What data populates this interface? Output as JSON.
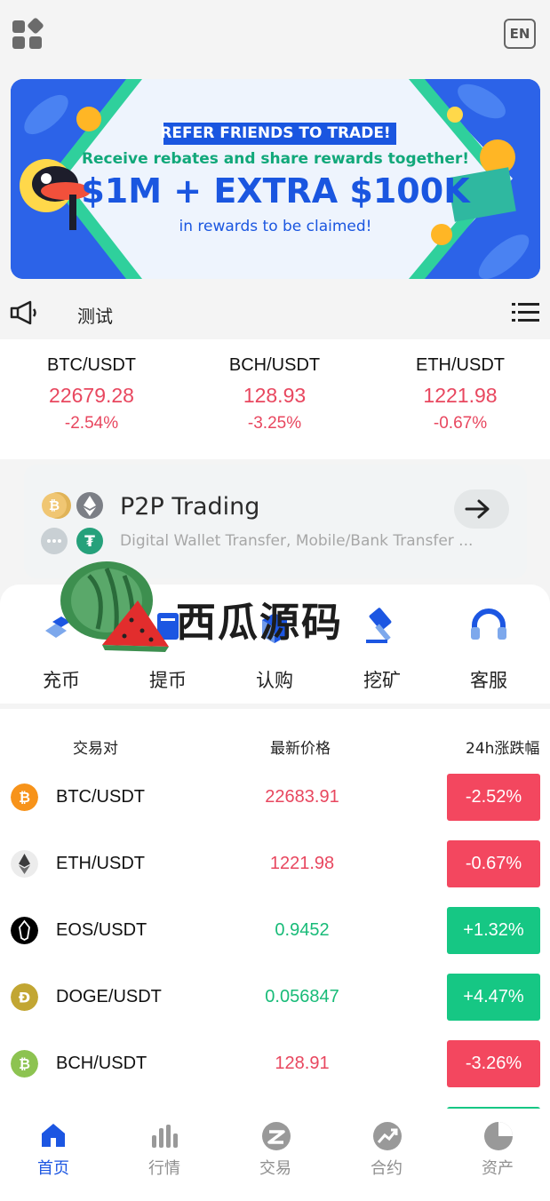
{
  "header": {
    "lang_label": "EN"
  },
  "banner": {
    "headline": "REFER FRIENDS TO TRADE!",
    "line2": "Receive rebates and share rewards together!",
    "line3": "$1M + EXTRA $100K",
    "line4": "in rewards to be claimed!"
  },
  "notice": {
    "text": "测试"
  },
  "tickers": [
    {
      "pair": "BTC/USDT",
      "price": "22679.28",
      "change": "-2.54%"
    },
    {
      "pair": "BCH/USDT",
      "price": "128.93",
      "change": "-3.25%"
    },
    {
      "pair": "ETH/USDT",
      "price": "1221.98",
      "change": "-0.67%"
    }
  ],
  "p2p": {
    "title": "P2P Trading",
    "subtitle": "Digital Wallet Transfer, Mobile/Bank Transfer ..."
  },
  "quick_actions": [
    {
      "label": "充币",
      "icon": "deposit-icon"
    },
    {
      "label": "提币",
      "icon": "withdraw-icon"
    },
    {
      "label": "认购",
      "icon": "subscribe-icon"
    },
    {
      "label": "挖矿",
      "icon": "mining-icon"
    },
    {
      "label": "客服",
      "icon": "headset-icon"
    }
  ],
  "watermark": {
    "text": "西瓜源码"
  },
  "market": {
    "headers": {
      "pair": "交易对",
      "price": "最新价格",
      "change": "24h涨跌幅"
    },
    "rows": [
      {
        "pair": "BTC/USDT",
        "price": "22683.91",
        "change": "-2.52%",
        "trend": "down",
        "icon": "btc-icon",
        "color": "#f7931a"
      },
      {
        "pair": "ETH/USDT",
        "price": "1221.98",
        "change": "-0.67%",
        "trend": "down",
        "icon": "eth-icon",
        "color": "#3c3c3d"
      },
      {
        "pair": "EOS/USDT",
        "price": "0.9452",
        "change": "+1.32%",
        "trend": "up",
        "icon": "eos-icon",
        "color": "#000000"
      },
      {
        "pair": "DOGE/USDT",
        "price": "0.056847",
        "change": "+4.47%",
        "trend": "up",
        "icon": "doge-icon",
        "color": "#c2a633"
      },
      {
        "pair": "BCH/USDT",
        "price": "128.91",
        "change": "-3.26%",
        "trend": "down",
        "icon": "bch-icon",
        "color": "#8dc351"
      }
    ]
  },
  "tabs": [
    {
      "label": "首页",
      "icon": "home-icon",
      "active": true
    },
    {
      "label": "行情",
      "icon": "market-icon",
      "active": false
    },
    {
      "label": "交易",
      "icon": "trade-icon",
      "active": false
    },
    {
      "label": "合约",
      "icon": "contract-icon",
      "active": false
    },
    {
      "label": "资产",
      "icon": "assets-icon",
      "active": false
    }
  ],
  "colors": {
    "accent": "#1c56e2",
    "up": "#16c784",
    "down": "#f3475f"
  }
}
